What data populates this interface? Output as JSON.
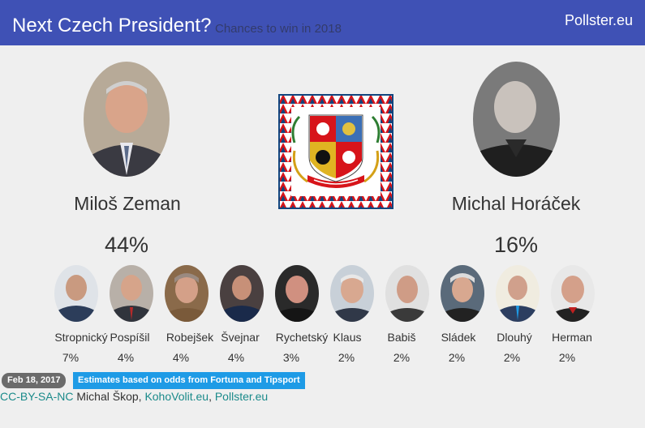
{
  "header": {
    "title": "Next Czech President?",
    "subtitle": "Chances to win in 2018",
    "brand": "Pollster.eu"
  },
  "colors": {
    "header_bg": "#3f51b5",
    "background": "#efefef",
    "badge_gray": "#6b6b6b",
    "badge_blue": "#1e9be6",
    "link": "#1a8a8a"
  },
  "leaders": [
    {
      "name": "Miloš Zeman",
      "percent": "44%"
    },
    {
      "name": "Michal Horáček",
      "percent": "16%"
    }
  ],
  "emblem": "czech-presidential-standard",
  "candidates": [
    {
      "name": "Stropnický",
      "percent": "7%"
    },
    {
      "name": "Pospíšil",
      "percent": "4%"
    },
    {
      "name": "Robejšek",
      "percent": "4%"
    },
    {
      "name": "Švejnar",
      "percent": "4%"
    },
    {
      "name": "Rychetský",
      "percent": "3%"
    },
    {
      "name": "Klaus",
      "percent": "2%"
    },
    {
      "name": "Babiš",
      "percent": "2%"
    },
    {
      "name": "Sládek",
      "percent": "2%"
    },
    {
      "name": "Dlouhý",
      "percent": "2%"
    },
    {
      "name": "Herman",
      "percent": "2%"
    }
  ],
  "footer": {
    "date": "Feb 18, 2017",
    "note": "Estimates based on odds from Fortuna and Tipsport",
    "license": "CC-BY-SA-NC",
    "author": " Michal Škop, ",
    "source1": "KohoVolit.eu",
    "separator": ", ",
    "source2": "Pollster.eu"
  }
}
